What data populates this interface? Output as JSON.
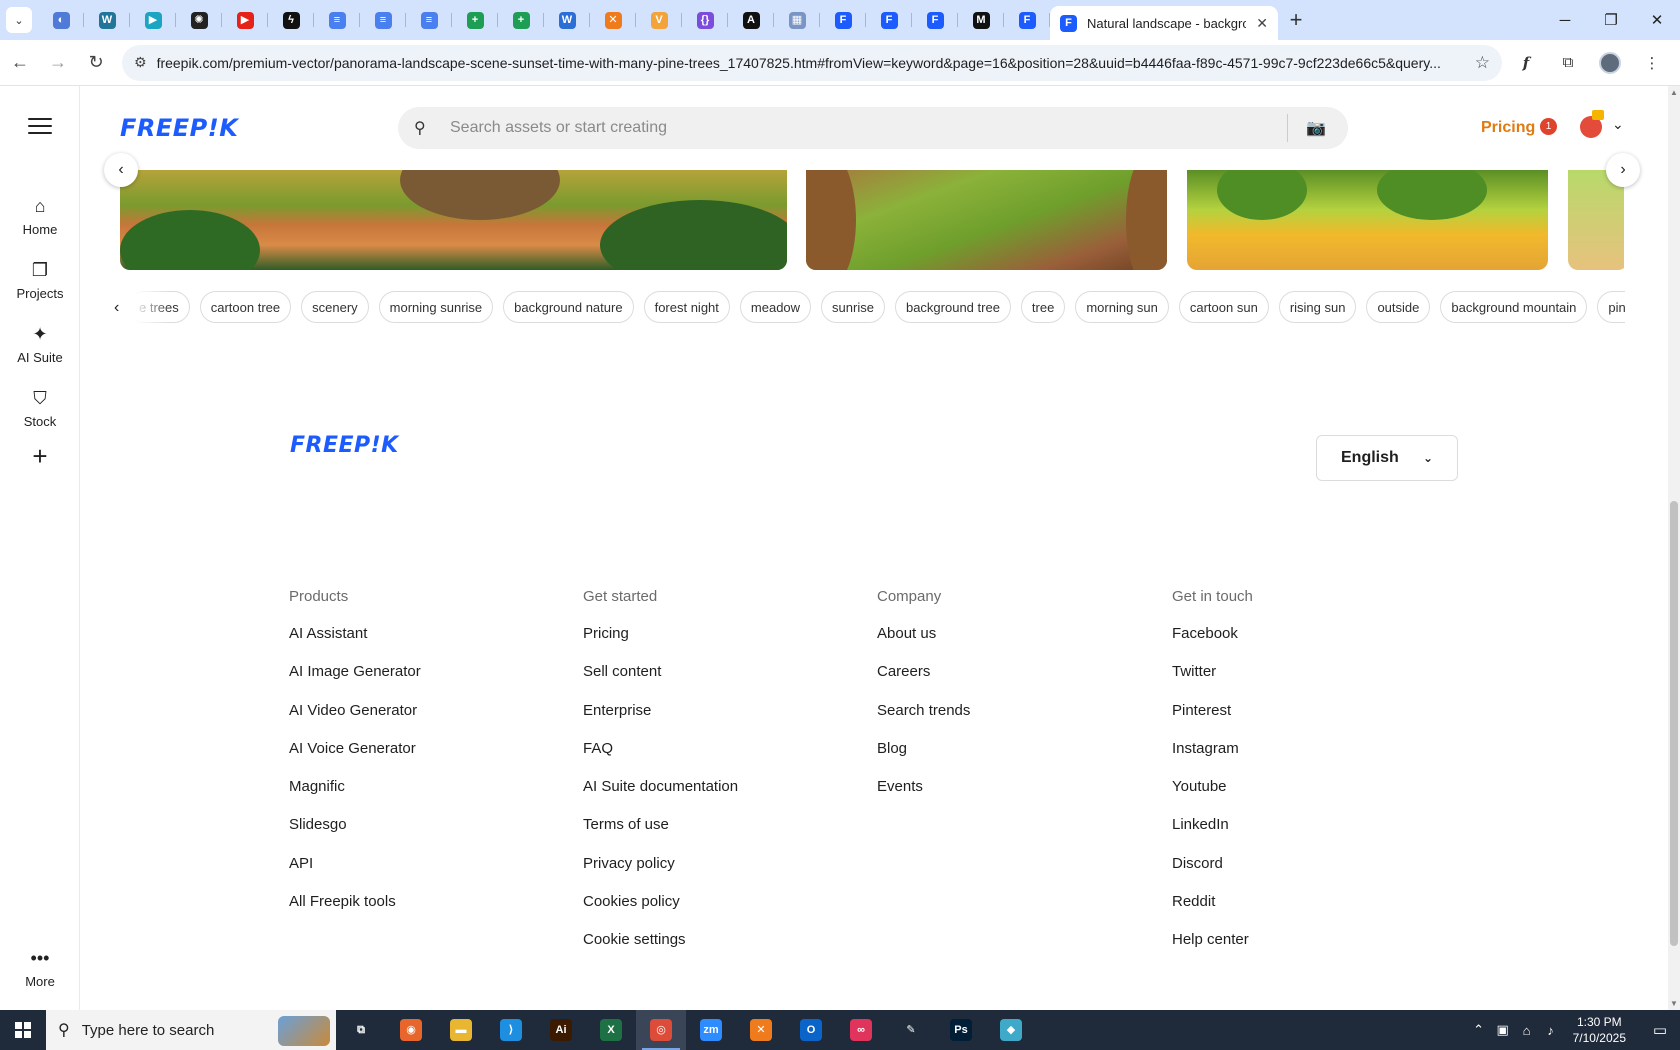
{
  "browser": {
    "pinned_tabs": [
      {
        "icon": "globe-icon",
        "color": "#4f7ad8",
        "glyph": "◐"
      },
      {
        "icon": "wordpress-icon",
        "color": "#21759b",
        "glyph": "W"
      },
      {
        "icon": "arrow-app-icon",
        "color": "#1aa6c2",
        "glyph": "▶"
      },
      {
        "icon": "openai-icon",
        "color": "#222222",
        "glyph": "✺"
      },
      {
        "icon": "youtube-icon",
        "color": "#e62117",
        "glyph": "▶"
      },
      {
        "icon": "bolt-icon",
        "color": "#111111",
        "glyph": "ϟ"
      },
      {
        "icon": "google-docs-icon",
        "color": "#4a7ff0",
        "glyph": "≡"
      },
      {
        "icon": "google-docs-icon",
        "color": "#4a7ff0",
        "glyph": "≡"
      },
      {
        "icon": "google-docs-icon",
        "color": "#4a7ff0",
        "glyph": "≡"
      },
      {
        "icon": "google-sheets-icon",
        "color": "#1e9e55",
        "glyph": "+"
      },
      {
        "icon": "google-sheets-icon",
        "color": "#1e9e55",
        "glyph": "+"
      },
      {
        "icon": "word-online-icon",
        "color": "#2b6fd6",
        "glyph": "W"
      },
      {
        "icon": "xampp-icon",
        "color": "#f07b1c",
        "glyph": "✕"
      },
      {
        "icon": "vue-icon",
        "color": "#f3a33a",
        "glyph": "V"
      },
      {
        "icon": "json-icon",
        "color": "#7c4ddc",
        "glyph": "{}"
      },
      {
        "icon": "a-app-icon",
        "color": "#111111",
        "glyph": "A"
      },
      {
        "icon": "grid-app-icon",
        "color": "#7a94c4",
        "glyph": "▦"
      },
      {
        "icon": "freepik-tab-icon",
        "color": "#1c5cff",
        "glyph": "F"
      },
      {
        "icon": "freepik-tab-icon",
        "color": "#1c5cff",
        "glyph": "F"
      },
      {
        "icon": "freepik-tab-icon",
        "color": "#1c5cff",
        "glyph": "F"
      },
      {
        "icon": "medium-icon",
        "color": "#111111",
        "glyph": "M"
      },
      {
        "icon": "freepik-tab-icon",
        "color": "#1c5cff",
        "glyph": "F"
      }
    ],
    "active_tab": {
      "title": "Natural landscape - background",
      "close": "✕"
    },
    "url": "freepik.com/premium-vector/panorama-landscape-scene-sunset-time-with-many-pine-trees_17407825.htm#fromView=keyword&page=16&position=28&uuid=b4446faa-f89c-4571-99c7-9cf223de66c5&query...",
    "window_controls": {
      "minimize": "─",
      "restore": "❐",
      "close": "✕"
    }
  },
  "sidebar": {
    "items": [
      {
        "label": "Home",
        "icon": "home-icon",
        "glyph": "⌂"
      },
      {
        "label": "Projects",
        "icon": "projects-icon",
        "glyph": "❐"
      },
      {
        "label": "AI Suite",
        "icon": "ai-sparkle-icon",
        "glyph": "✦"
      },
      {
        "label": "Stock",
        "icon": "stock-icon",
        "glyph": "⛉"
      }
    ],
    "more_label": "More",
    "more_glyph": "•••"
  },
  "header": {
    "logo": "FREEP!K",
    "search_placeholder": "Search assets or start creating",
    "pricing": "Pricing",
    "notification_count": "1"
  },
  "tags": [
    "e trees",
    "cartoon tree",
    "scenery",
    "morning sunrise",
    "background nature",
    "forest night",
    "meadow",
    "sunrise",
    "background tree",
    "tree",
    "morning sun",
    "cartoon sun",
    "rising sun",
    "outside",
    "background mountain",
    "pine"
  ],
  "footer": {
    "logo": "FREEP!K",
    "language": "English",
    "columns": [
      {
        "heading": "Products",
        "links": [
          "AI Assistant",
          "AI Image Generator",
          "AI Video Generator",
          "AI Voice Generator",
          "Magnific",
          "Slidesgo",
          "API",
          "All Freepik tools"
        ]
      },
      {
        "heading": "Get started",
        "links": [
          "Pricing",
          "Sell content",
          "Enterprise",
          "FAQ",
          "AI Suite documentation",
          "Terms of use",
          "Privacy policy",
          "Cookies policy",
          "Cookie settings"
        ]
      },
      {
        "heading": "Company",
        "links": [
          "About us",
          "Careers",
          "Search trends",
          "Blog",
          "Events"
        ]
      },
      {
        "heading": "Get in touch",
        "links": [
          "Facebook",
          "Twitter",
          "Pinterest",
          "Instagram",
          "Youtube",
          "LinkedIn",
          "Discord",
          "Reddit",
          "Help center"
        ]
      }
    ]
  },
  "taskbar": {
    "search_placeholder": "Type here to search",
    "apps": [
      {
        "icon": "task-view-icon",
        "color": "#1f2a3a",
        "glyph": "⧉"
      },
      {
        "icon": "firefox-icon",
        "color": "#e8662b",
        "glyph": "◉"
      },
      {
        "icon": "file-explorer-icon",
        "color": "#e9b632",
        "glyph": "▬"
      },
      {
        "icon": "vscode-icon",
        "color": "#1d8ee0",
        "glyph": "⟩"
      },
      {
        "icon": "illustrator-icon",
        "color": "#3c1a00",
        "glyph": "Ai"
      },
      {
        "icon": "excel-icon",
        "color": "#1e7145",
        "glyph": "X"
      },
      {
        "icon": "chrome-icon",
        "color": "#dd4b39",
        "glyph": "◎"
      },
      {
        "icon": "zoom-icon",
        "color": "#2d8cff",
        "glyph": "zm"
      },
      {
        "icon": "xampp-icon",
        "color": "#f07b1c",
        "glyph": "✕"
      },
      {
        "icon": "outlook-icon",
        "color": "#0a64c9",
        "glyph": "O"
      },
      {
        "icon": "creative-cloud-icon",
        "color": "#e0345c",
        "glyph": "∞"
      },
      {
        "icon": "pen-tool-icon",
        "color": "#1f2a3a",
        "glyph": "✎"
      },
      {
        "icon": "photoshop-icon",
        "color": "#001e36",
        "glyph": "Ps"
      },
      {
        "icon": "diamond-app-icon",
        "color": "#3fa9c9",
        "glyph": "◆"
      }
    ],
    "time": "1:30 PM",
    "date": "7/10/2025"
  }
}
